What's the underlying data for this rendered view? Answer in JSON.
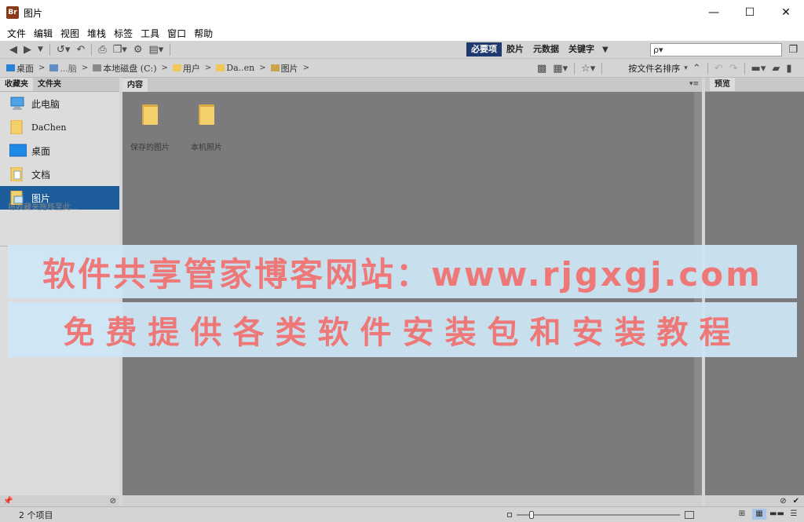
{
  "window": {
    "title": "图片",
    "app_icon": "Br",
    "controls": {
      "minimize": "—",
      "maximize": "☐",
      "close": "✕"
    }
  },
  "menu": [
    "文件",
    "编辑",
    "视图",
    "堆栈",
    "标签",
    "工具",
    "窗口",
    "帮助"
  ],
  "toolbar": {
    "workspaces": [
      "必要项",
      "胶片",
      "元数据",
      "关键字"
    ],
    "active_workspace": "必要项",
    "search_placeholder": "ρ▾"
  },
  "breadcrumb": [
    "桌面",
    "...脑",
    "本地磁盘 (C:)",
    "用户",
    "Da..en",
    "图片"
  ],
  "sort": {
    "label": "按文件名排序"
  },
  "left_panel": {
    "tabs": [
      "收藏夹",
      "文件夹"
    ],
    "items": [
      {
        "label": "此电脑",
        "icon": "computer-icon"
      },
      {
        "label": "DaChen",
        "icon": "user-folder-icon"
      },
      {
        "label": "桌面",
        "icon": "desktop-icon"
      },
      {
        "label": "文档",
        "icon": "documents-icon"
      },
      {
        "label": "图片",
        "icon": "pictures-icon",
        "selected": true
      }
    ],
    "hint": "将收藏夹拖移至此..."
  },
  "content": {
    "tab": "内容",
    "folders": [
      {
        "label": "保存的图片"
      },
      {
        "label": "本机照片"
      }
    ]
  },
  "preview": {
    "tab": "预览"
  },
  "status": {
    "item_count": "2 个项目",
    "zoom_fraction": 0.08
  },
  "watermark": {
    "line1": "软件共享管家博客网站：www.rjgxgj.com",
    "line2": "免费提供各类软件安装包和安装教程"
  },
  "colors": {
    "selected": "#1d5d9b",
    "workspace_active": "#1f3a6e",
    "content_bg": "#7b7a7c",
    "folder": "#f4d06a",
    "watermark_text": "#ee7878"
  }
}
